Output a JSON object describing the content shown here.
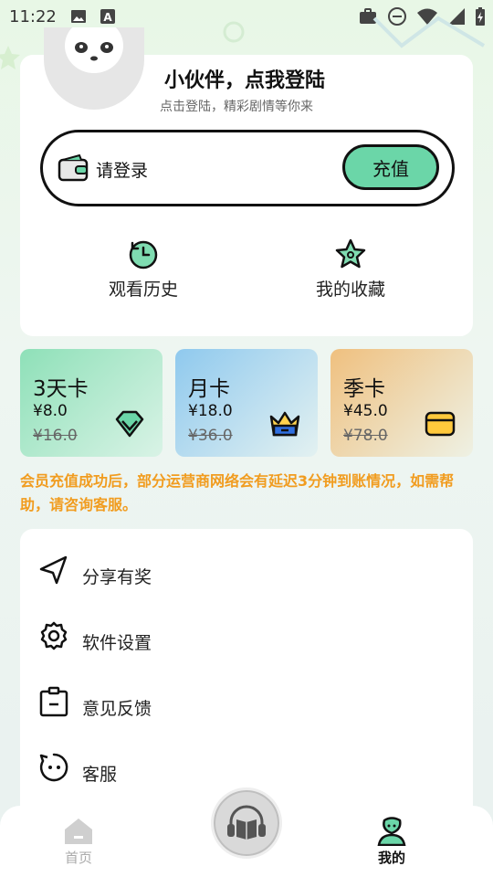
{
  "status_bar": {
    "time": "11:22",
    "icons_left": [
      "image-icon",
      "a-box-icon"
    ],
    "icons_right": [
      "briefcase-icon",
      "dnd-icon",
      "wifi-icon",
      "signal-icon",
      "battery-charging-icon"
    ]
  },
  "profile": {
    "title": "小伙伴，点我登陆",
    "subtitle": "点击登陆，精彩剧情等你来",
    "wallet_text": "请登录",
    "recharge_label": "充值"
  },
  "quick_actions": [
    {
      "label": "观看历史",
      "icon": "history-icon"
    },
    {
      "label": "我的收藏",
      "icon": "star-icon"
    }
  ],
  "vip_cards": [
    {
      "title": "3天卡",
      "price": "¥8.0",
      "original": "¥16.0",
      "icon": "diamond-icon",
      "bg": "#97e3bd"
    },
    {
      "title": "月卡",
      "price": "¥18.0",
      "original": "¥36.0",
      "icon": "crown-icon",
      "bg": "#9fd0ee"
    },
    {
      "title": "季卡",
      "price": "¥45.0",
      "original": "¥78.0",
      "icon": "card-icon",
      "bg": "#f0c88f"
    }
  ],
  "notice": "会员充值成功后，部分运营商网络会有延迟3分钟到账情况，如需帮助，请咨询客服。",
  "menu": [
    {
      "label": "分享有奖",
      "icon": "share-icon"
    },
    {
      "label": "软件设置",
      "icon": "gear-icon"
    },
    {
      "label": "意见反馈",
      "icon": "feedback-icon"
    },
    {
      "label": "客服",
      "icon": "support-icon"
    }
  ],
  "nav": {
    "home_label": "首页",
    "mine_label": "我的"
  },
  "colors": {
    "accent_green": "#6bd6a8",
    "notice_orange": "#f19c1f"
  }
}
